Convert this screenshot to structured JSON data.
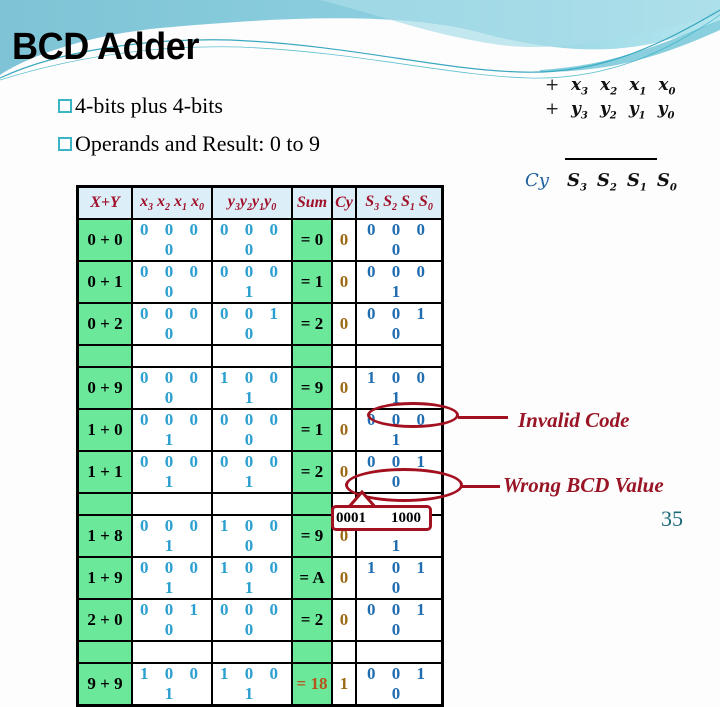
{
  "slide": {
    "title": "BCD Adder",
    "bullets": [
      {
        "icon": "square-bullet-icon",
        "text": "4-bits plus 4-bits"
      },
      {
        "icon": "square-bullet-icon",
        "text": "Operands and Result: 0 to 9"
      }
    ],
    "page_number": "35",
    "colors": {
      "accent": "#3bb4c4",
      "highlight": "#a31020",
      "cell_green": "#6be89a",
      "header_bg": "#dceef7"
    }
  },
  "formula": {
    "row1": {
      "op": "+",
      "terms": [
        "x",
        "x",
        "x",
        "x"
      ],
      "subs": [
        "3",
        "2",
        "1",
        "0"
      ]
    },
    "row2": {
      "op": "+",
      "terms": [
        "y",
        "y",
        "y",
        "y"
      ],
      "subs": [
        "3",
        "2",
        "1",
        "0"
      ]
    },
    "result": {
      "carry": "Cy",
      "terms": [
        "S",
        "S",
        "S",
        "S"
      ],
      "subs": [
        "3",
        "2",
        "1",
        "0"
      ]
    }
  },
  "table": {
    "headers": {
      "xy": "X+Y",
      "x": {
        "base": "x",
        "subs": [
          "3",
          "2",
          "1",
          "0"
        ]
      },
      "y": {
        "base": "y",
        "subs": [
          "3",
          "2",
          "1",
          "0"
        ]
      },
      "sum": "Sum",
      "cy": "Cy",
      "s": {
        "base": "S",
        "subs": [
          "3",
          "2",
          "1",
          "0"
        ]
      }
    },
    "rows": [
      {
        "xy": "0 + 0",
        "x": "0 0 0 0",
        "y": "0 0 0 0",
        "sum": "= 0",
        "cy": "0",
        "s": "0 0 0 0"
      },
      {
        "xy": "0 + 1",
        "x": "0 0 0 0",
        "y": "0 0 0 1",
        "sum": "= 1",
        "cy": "0",
        "s": "0 0 0 1"
      },
      {
        "xy": "0 + 2",
        "x": "0 0 0 0",
        "y": "0 0 1 0",
        "sum": "= 2",
        "cy": "0",
        "s": "0 0 1 0"
      },
      {
        "xy": "",
        "x": "",
        "y": "",
        "sum": "",
        "cy": "",
        "s": ""
      },
      {
        "xy": "0 + 9",
        "x": "0 0 0 0",
        "y": "1 0 0 1",
        "sum": "= 9",
        "cy": "0",
        "s": "1 0 0 1"
      },
      {
        "xy": "1 + 0",
        "x": "0 0 0 1",
        "y": "0 0 0 0",
        "sum": "= 1",
        "cy": "0",
        "s": "0 0 0 1"
      },
      {
        "xy": "1 + 1",
        "x": "0 0 0 1",
        "y": "0 0 0 1",
        "sum": "= 2",
        "cy": "0",
        "s": "0 0 1 0"
      },
      {
        "xy": "",
        "x": "",
        "y": "",
        "sum": "",
        "cy": "",
        "s": ""
      },
      {
        "xy": "1 + 8",
        "x": "0 0 0 1",
        "y": "1 0 0 0",
        "sum": "= 9",
        "cy": "0",
        "s": "1 0 0 1"
      },
      {
        "xy": "1 + 9",
        "x": "0 0 0 1",
        "y": "1 0 0 1",
        "sum": "= A",
        "cy": "0",
        "s": "1 0 1 0"
      },
      {
        "xy": "2 + 0",
        "x": "0 0 1 0",
        "y": "0 0 0 0",
        "sum": "= 2",
        "cy": "0",
        "s": "0 0 1 0"
      },
      {
        "xy": "",
        "x": "",
        "y": "",
        "sum": "",
        "cy": "",
        "s": ""
      },
      {
        "xy": "9 + 9",
        "x": "1 0 0 1",
        "y": "1 0 0 1",
        "sum": "= 18",
        "cy": "1",
        "s": "0 0 1 0"
      }
    ]
  },
  "annotations": {
    "invalid_code": "Invalid Code",
    "wrong_bcd": "Wrong BCD Value",
    "correct_bcd": [
      "0001",
      "1000"
    ]
  }
}
